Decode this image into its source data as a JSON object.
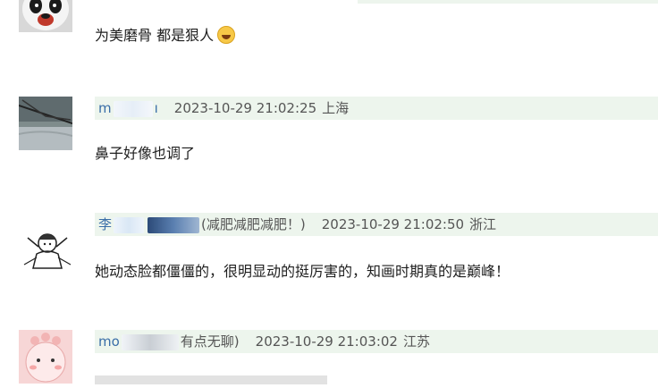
{
  "comments": [
    {
      "text": "为美磨骨 都是狠人"
    },
    {
      "name_visible": "m",
      "time": "2023-10-29 21:02:25",
      "location": "上海",
      "text": "鼻子好像也调了"
    },
    {
      "name_visible": "李",
      "name_suffix": "(减肥减肥减肥！)",
      "time": "2023-10-29 21:02:50",
      "location": "浙江",
      "text": "她动态脸都僵僵的，很明显动的挺厉害的，知画时期真的是巅峰！"
    },
    {
      "name_visible": "mo",
      "name_suffix": "有点无聊)",
      "time": "2023-10-29 21:03:02",
      "location": "江苏"
    }
  ],
  "icons": {
    "emoji": "laughing-tears-emoji",
    "avatar1": "panda-avatar",
    "avatar2": "landscape-photo-avatar",
    "avatar3": "cartoon-sketch-avatar",
    "avatar4": "pink-cartoon-avatar"
  },
  "colors": {
    "meta_bg": "#edf5ed",
    "name": "#3a6ea8",
    "meta_text": "#555555"
  }
}
